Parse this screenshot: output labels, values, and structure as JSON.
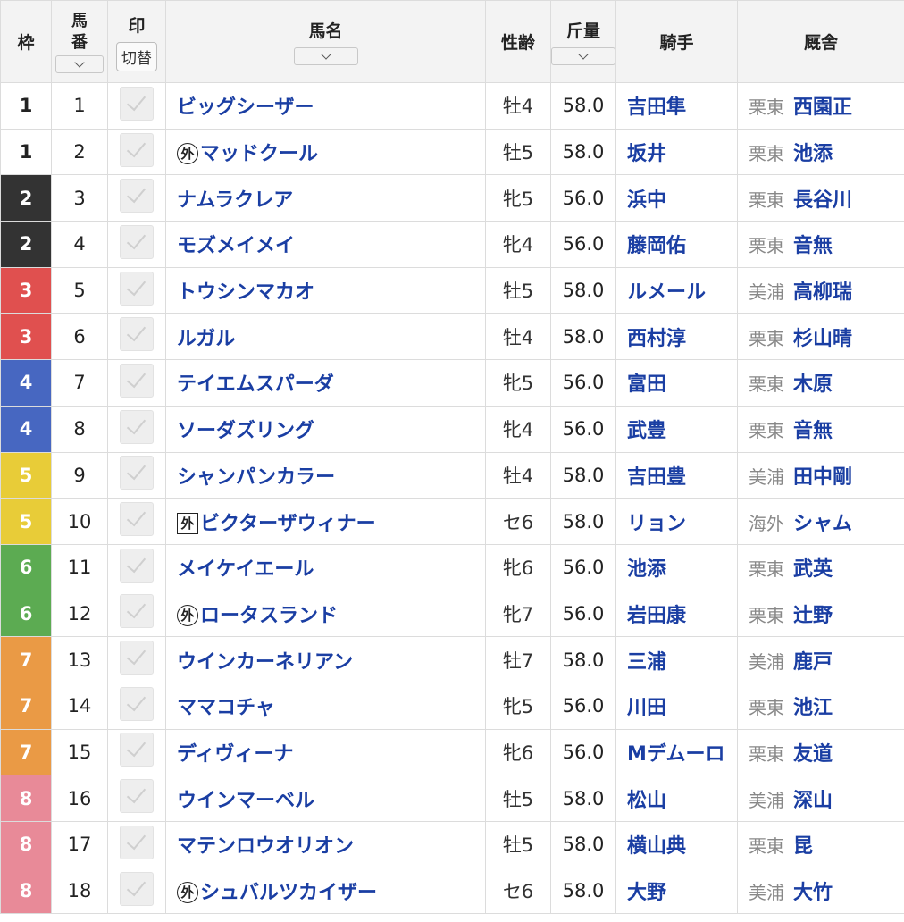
{
  "headers": {
    "waku": "枠",
    "umaban": [
      "馬",
      "番"
    ],
    "shirushi": "印",
    "switch_label": "切替",
    "name": "馬名",
    "sexage": "性齢",
    "weight": "斤量",
    "jockey": "騎手",
    "stable": "厩舎"
  },
  "waku_colors": {
    "1": {
      "bg": "#ffffff",
      "fg": "#222222"
    },
    "2": {
      "bg": "#333333",
      "fg": "#ffffff"
    },
    "3": {
      "bg": "#e0504f",
      "fg": "#ffffff"
    },
    "4": {
      "bg": "#4767c1",
      "fg": "#ffffff"
    },
    "5": {
      "bg": "#e8cc38",
      "fg": "#ffffff"
    },
    "6": {
      "bg": "#5cab52",
      "fg": "#ffffff"
    },
    "7": {
      "bg": "#ea9a45",
      "fg": "#ffffff"
    },
    "8": {
      "bg": "#e88a98",
      "fg": "#ffffff"
    }
  },
  "rows": [
    {
      "waku": "1",
      "num": "1",
      "mark": "",
      "mark_style": "",
      "name": "ビッグシーザー",
      "sexage": "牡4",
      "weight": "58.0",
      "jockey": "吉田隼",
      "region": "栗東",
      "trainer": "西園正"
    },
    {
      "waku": "1",
      "num": "2",
      "mark": "外",
      "mark_style": "circle",
      "name": "マッドクール",
      "sexage": "牡5",
      "weight": "58.0",
      "jockey": "坂井",
      "region": "栗東",
      "trainer": "池添"
    },
    {
      "waku": "2",
      "num": "3",
      "mark": "",
      "mark_style": "",
      "name": "ナムラクレア",
      "sexage": "牝5",
      "weight": "56.0",
      "jockey": "浜中",
      "region": "栗東",
      "trainer": "長谷川"
    },
    {
      "waku": "2",
      "num": "4",
      "mark": "",
      "mark_style": "",
      "name": "モズメイメイ",
      "sexage": "牝4",
      "weight": "56.0",
      "jockey": "藤岡佑",
      "region": "栗東",
      "trainer": "音無"
    },
    {
      "waku": "3",
      "num": "5",
      "mark": "",
      "mark_style": "",
      "name": "トウシンマカオ",
      "sexage": "牡5",
      "weight": "58.0",
      "jockey": "ルメール",
      "region": "美浦",
      "trainer": "高柳瑞"
    },
    {
      "waku": "3",
      "num": "6",
      "mark": "",
      "mark_style": "",
      "name": "ルガル",
      "sexage": "牡4",
      "weight": "58.0",
      "jockey": "西村淳",
      "region": "栗東",
      "trainer": "杉山晴"
    },
    {
      "waku": "4",
      "num": "7",
      "mark": "",
      "mark_style": "",
      "name": "テイエムスパーダ",
      "sexage": "牝5",
      "weight": "56.0",
      "jockey": "富田",
      "region": "栗東",
      "trainer": "木原"
    },
    {
      "waku": "4",
      "num": "8",
      "mark": "",
      "mark_style": "",
      "name": "ソーダズリング",
      "sexage": "牝4",
      "weight": "56.0",
      "jockey": "武豊",
      "region": "栗東",
      "trainer": "音無"
    },
    {
      "waku": "5",
      "num": "9",
      "mark": "",
      "mark_style": "",
      "name": "シャンパンカラー",
      "sexage": "牡4",
      "weight": "58.0",
      "jockey": "吉田豊",
      "region": "美浦",
      "trainer": "田中剛"
    },
    {
      "waku": "5",
      "num": "10",
      "mark": "外",
      "mark_style": "box",
      "name": "ビクターザウィナー",
      "sexage": "セ6",
      "weight": "58.0",
      "jockey": "リョン",
      "region": "海外",
      "trainer": "シャム"
    },
    {
      "waku": "6",
      "num": "11",
      "mark": "",
      "mark_style": "",
      "name": "メイケイエール",
      "sexage": "牝6",
      "weight": "56.0",
      "jockey": "池添",
      "region": "栗東",
      "trainer": "武英"
    },
    {
      "waku": "6",
      "num": "12",
      "mark": "外",
      "mark_style": "circle",
      "name": "ロータスランド",
      "sexage": "牝7",
      "weight": "56.0",
      "jockey": "岩田康",
      "region": "栗東",
      "trainer": "辻野"
    },
    {
      "waku": "7",
      "num": "13",
      "mark": "",
      "mark_style": "",
      "name": "ウインカーネリアン",
      "sexage": "牡7",
      "weight": "58.0",
      "jockey": "三浦",
      "region": "美浦",
      "trainer": "鹿戸"
    },
    {
      "waku": "7",
      "num": "14",
      "mark": "",
      "mark_style": "",
      "name": "ママコチャ",
      "sexage": "牝5",
      "weight": "56.0",
      "jockey": "川田",
      "region": "栗東",
      "trainer": "池江"
    },
    {
      "waku": "7",
      "num": "15",
      "mark": "",
      "mark_style": "",
      "name": "ディヴィーナ",
      "sexage": "牝6",
      "weight": "56.0",
      "jockey": "Mデムーロ",
      "region": "栗東",
      "trainer": "友道"
    },
    {
      "waku": "8",
      "num": "16",
      "mark": "",
      "mark_style": "",
      "name": "ウインマーベル",
      "sexage": "牡5",
      "weight": "58.0",
      "jockey": "松山",
      "region": "美浦",
      "trainer": "深山"
    },
    {
      "waku": "8",
      "num": "17",
      "mark": "",
      "mark_style": "",
      "name": "マテンロウオリオン",
      "sexage": "牡5",
      "weight": "58.0",
      "jockey": "横山典",
      "region": "栗東",
      "trainer": "昆"
    },
    {
      "waku": "8",
      "num": "18",
      "mark": "外",
      "mark_style": "circle",
      "name": "シュバルツカイザー",
      "sexage": "セ6",
      "weight": "58.0",
      "jockey": "大野",
      "region": "美浦",
      "trainer": "大竹"
    }
  ]
}
